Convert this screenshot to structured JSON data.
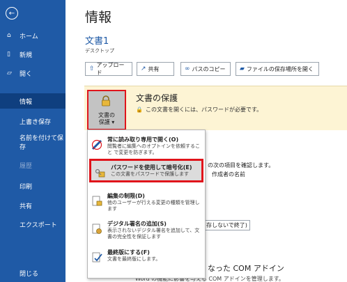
{
  "sidebar": {
    "items": [
      {
        "label": "ホーム",
        "icon": "home-icon"
      },
      {
        "label": "新規",
        "icon": "new-doc-icon"
      },
      {
        "label": "開く",
        "icon": "folder-open-icon"
      },
      {
        "label": "情報"
      },
      {
        "label": "上書き保存"
      },
      {
        "label": "名前を付けて保存"
      },
      {
        "label": "履歴"
      },
      {
        "label": "印刷"
      },
      {
        "label": "共有"
      },
      {
        "label": "エクスポート"
      },
      {
        "label": "閉じる"
      }
    ]
  },
  "main": {
    "title": "情報",
    "doc_name": "文書1",
    "doc_location": "デスクトップ",
    "toolbar": {
      "upload": "アップロード",
      "share": "共有",
      "copy_path": "パスのコピー",
      "open_location": "ファイルの保存場所を開く"
    },
    "protect": {
      "button_label_line1": "文書の",
      "button_label_line2": "保護 ▾",
      "title": "文書の保護",
      "desc": "この文書を開くには、パスワードが必要です。"
    },
    "background": {
      "text1": "の次の項目を確認します。",
      "text2": "作成者の名前",
      "text3": "存しないで終了)",
      "text4": "なった COM アドイン",
      "text5": "Word の機能に影響を与える COM アドインを管理します。"
    }
  },
  "menu": {
    "items": [
      {
        "label": "常に読み取り専用で開く(O)",
        "desc": "閲覧者に編集へのオプトインを依頼すること で変更を防ぎます。"
      },
      {
        "label": "パスワードを使用して暗号化(E)",
        "desc": "この文書をパスワードで保護します"
      },
      {
        "label": "編集の制限(D)",
        "desc": "他のユーザーが行える変更の種類を管理します"
      },
      {
        "label": "デジタル署名の追加(S)",
        "desc": "表示されないデジタル署名を追加して、文書の完全性を保証します"
      },
      {
        "label": "最終版にする(F)",
        "desc": "文書を最終版にします。"
      }
    ]
  },
  "colors": {
    "sidebar": "#1f5aa6",
    "active": "#0f3f7f",
    "highlight_border": "#e0141b",
    "panel": "#fdf4d4"
  }
}
